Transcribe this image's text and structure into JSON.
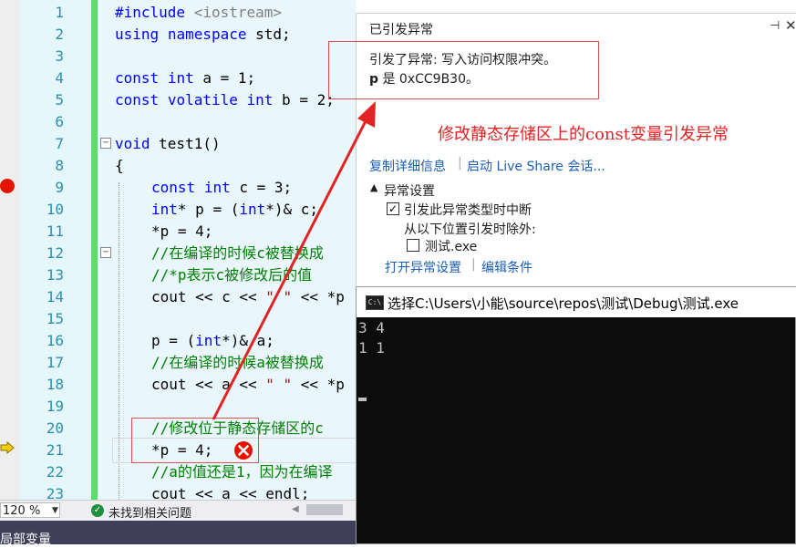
{
  "editor": {
    "line_numbers": [
      "1",
      "2",
      "3",
      "4",
      "5",
      "6",
      "7",
      "8",
      "9",
      "10",
      "11",
      "12",
      "13",
      "14",
      "15",
      "16",
      "17",
      "18",
      "19",
      "20",
      "21",
      "22",
      "23"
    ],
    "lines": {
      "l1": {
        "a": "#include ",
        "b": "<iostream>"
      },
      "l2": {
        "a": "using",
        "b": " ",
        "c": "namespace",
        "d": " std;"
      },
      "l4": {
        "a": "const",
        "b": " ",
        "c": "int",
        "d": " a = 1;"
      },
      "l5": {
        "a": "const",
        "b": " ",
        "c": "volatile",
        "d": " ",
        "e": "int",
        "f": " b = 2;"
      },
      "l7": {
        "a": "void",
        "b": " test1()"
      },
      "l8": "{",
      "l9": {
        "a": "const",
        "b": " ",
        "c": "int",
        "d": " c = 3;"
      },
      "l10": {
        "a": "int",
        "b": "* p = (",
        "c": "int",
        "d": "*)& c;"
      },
      "l11": "*p = 4;",
      "l12": "//在编译的时候c被替换成",
      "l13": "//*p表示c被修改后的值",
      "l14": {
        "a": "cout << c << ",
        "b": "\" \"",
        "c": " << *p"
      },
      "l16": {
        "a": "p = (",
        "b": "int",
        "c": "*)& a;"
      },
      "l17": "//在编译的时候a被替换成",
      "l18": {
        "a": "cout << a << ",
        "b": "\" \"",
        "c": " << *p"
      },
      "l20": "//修改位于静态存储区的c",
      "l21": "*p = 4;",
      "l22": "//a的值还是1，因为在编译",
      "l23": "cout << a << endl;"
    }
  },
  "exception_popup": {
    "title": "已引发异常",
    "message_line1": "引发了异常: 写入访问权限冲突。",
    "message_line2_var": "p",
    "message_line2_rest": " 是 0xCC9B30。",
    "copy_details": "复制详细信息",
    "live_share": "启动 Live Share 会话...",
    "settings_header": "异常设置",
    "break_option": "引发此异常类型时中断",
    "except_from": "从以下位置引发时除外:",
    "exe_option": "测试.exe",
    "open_settings": "打开异常设置",
    "edit_conditions": "编辑条件",
    "pin_glyph": "⊣",
    "close_glyph": "✕"
  },
  "annotation_text": "修改静态存储区上的const变量引发异常",
  "console": {
    "title": "选择C:\\Users\\小能\\source\\repos\\测试\\Debug\\测试.exe",
    "icon_text": "C:\\",
    "lines": [
      "3 4",
      "1 1"
    ]
  },
  "status": {
    "zoom": "120 %",
    "issues": "未找到相关问题"
  },
  "bottom_panel": {
    "label": "局部变量"
  },
  "colors": {
    "keyword": "#0000ff",
    "comment": "#008000",
    "string": "#a31515",
    "annotation": "#e32323",
    "link": "#1a5fb4"
  }
}
